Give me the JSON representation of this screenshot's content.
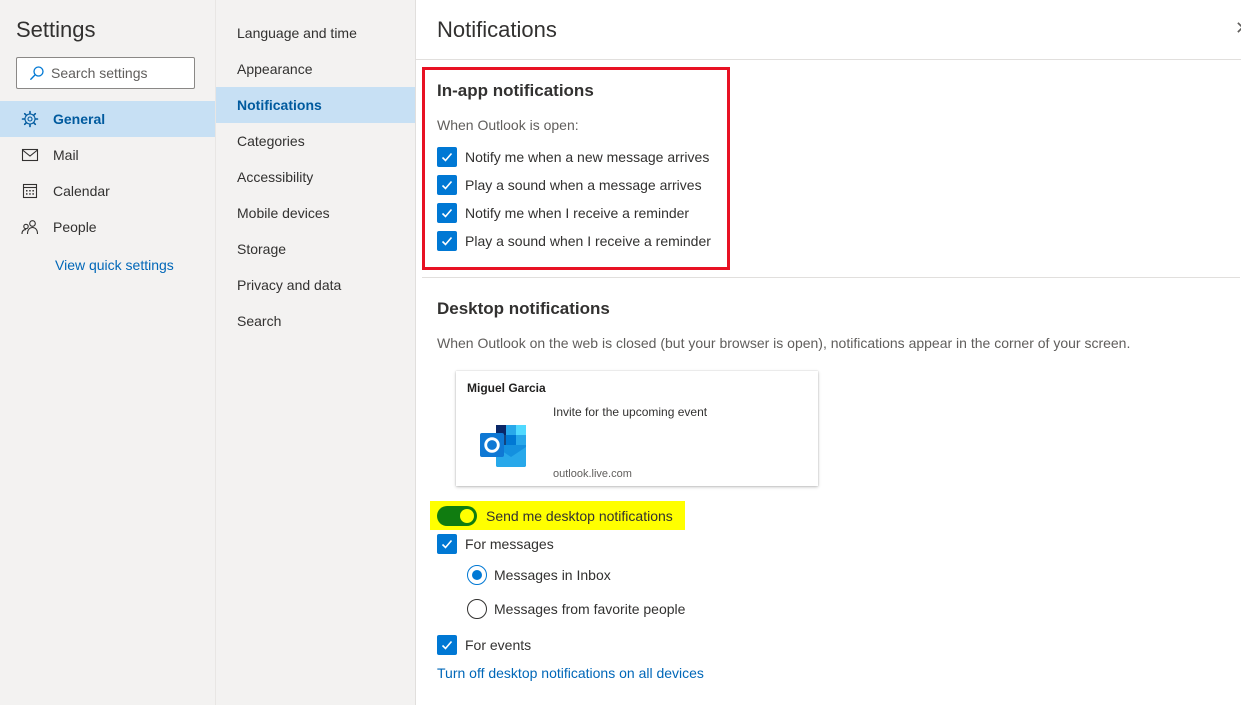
{
  "app": {
    "title": "Settings"
  },
  "search": {
    "placeholder": "Search settings"
  },
  "categories": [
    {
      "label": "General",
      "icon": "gear-icon",
      "active": true
    },
    {
      "label": "Mail",
      "icon": "mail-icon",
      "active": false
    },
    {
      "label": "Calendar",
      "icon": "calendar-icon",
      "active": false
    },
    {
      "label": "People",
      "icon": "people-icon",
      "active": false
    }
  ],
  "quick_settings_link": "View quick settings",
  "subsections": [
    {
      "label": "Language and time",
      "active": false
    },
    {
      "label": "Appearance",
      "active": false
    },
    {
      "label": "Notifications",
      "active": true
    },
    {
      "label": "Categories",
      "active": false
    },
    {
      "label": "Accessibility",
      "active": false
    },
    {
      "label": "Mobile devices",
      "active": false
    },
    {
      "label": "Storage",
      "active": false
    },
    {
      "label": "Privacy and data",
      "active": false
    },
    {
      "label": "Search",
      "active": false
    }
  ],
  "panel": {
    "title": "Notifications",
    "close_icon": "close-icon",
    "in_app": {
      "title": "In-app notifications",
      "description": "When Outlook is open:",
      "options": [
        {
          "label": "Notify me when a new message arrives",
          "checked": true
        },
        {
          "label": "Play a sound when a message arrives",
          "checked": true
        },
        {
          "label": "Notify me when I receive a reminder",
          "checked": true
        },
        {
          "label": "Play a sound when I receive a reminder",
          "checked": true
        }
      ]
    },
    "desktop": {
      "title": "Desktop notifications",
      "description": "When Outlook on the web is closed (but your browser is open), notifications appear in the corner of your screen.",
      "preview": {
        "sender": "Miguel Garcia",
        "message": "Invite for the upcoming event",
        "domain": "outlook.live.com",
        "logo_icon": "outlook-logo-icon"
      },
      "toggle": {
        "label": "Send me desktop notifications",
        "on": true
      },
      "for_messages": {
        "label": "For messages",
        "checked": true
      },
      "message_options": [
        {
          "label": "Messages in Inbox",
          "selected": true
        },
        {
          "label": "Messages from favorite people",
          "selected": false
        }
      ],
      "for_events": {
        "label": "For events",
        "checked": true
      },
      "turn_off_link": "Turn off desktop notifications on all devices"
    }
  },
  "colors": {
    "accent": "#0078d4",
    "selected_bg": "#c7e0f4",
    "toggle_on": "#107c10",
    "highlight_red": "#e81123",
    "highlight_yellow": "#ffff00"
  }
}
